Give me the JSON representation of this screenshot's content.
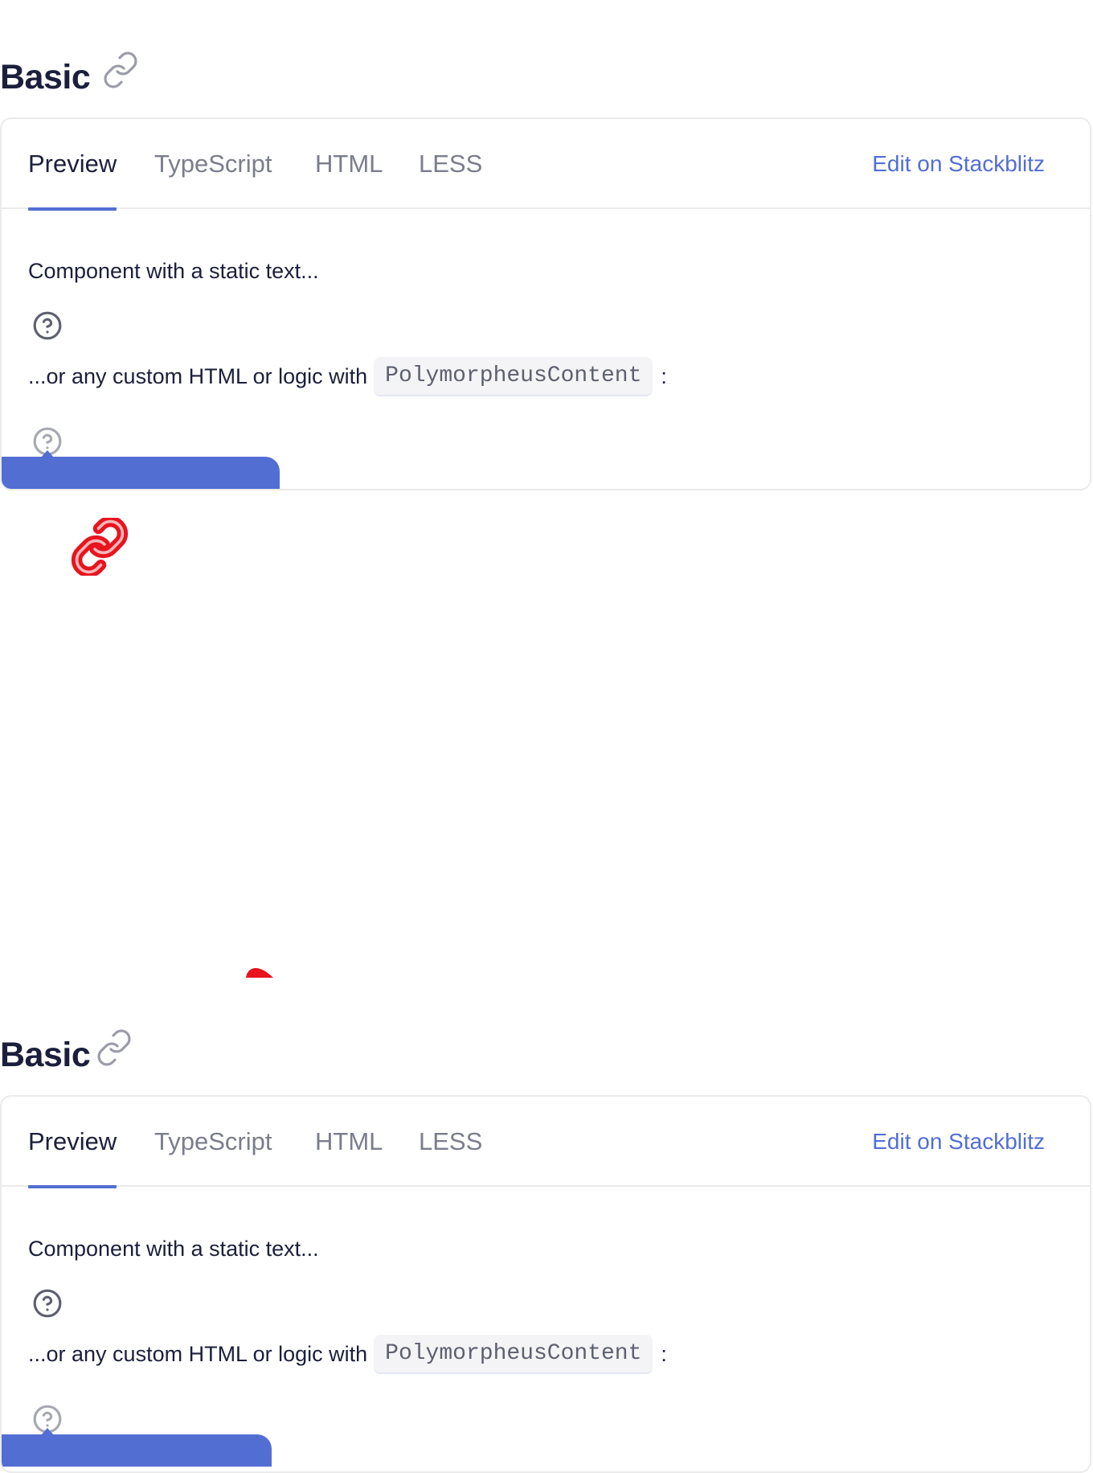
{
  "sections": [
    {
      "title": "Basic",
      "tabs": [
        "Preview",
        "TypeScript",
        "HTML",
        "LESS"
      ],
      "active_tab": "Preview",
      "edit_link": "Edit on Stackblitz",
      "content": {
        "line1": "Component with a static text...",
        "line2_prefix": "...or any custom HTML or logic with",
        "code": "PolymorpheusContent",
        "line2_suffix": ":"
      }
    },
    {
      "title": "Basic",
      "tabs": [
        "Preview",
        "TypeScript",
        "HTML",
        "LESS"
      ],
      "active_tab": "Preview",
      "edit_link": "Edit on Stackblitz",
      "content": {
        "line1": "Component with a static text...",
        "line2_prefix": "...or any custom HTML or logic with",
        "code": "PolymorpheusContent",
        "line2_suffix": ":"
      }
    }
  ],
  "colors": {
    "accent": "#526ed3",
    "text": "#1b1f3b",
    "muted": "#7a7d8c",
    "border": "#ebebeb",
    "artifact_red": "#e8141e"
  },
  "icons": {
    "anchor": "link-icon",
    "help": "question-circle-icon",
    "artifact": "red-link-cursor-icon"
  }
}
